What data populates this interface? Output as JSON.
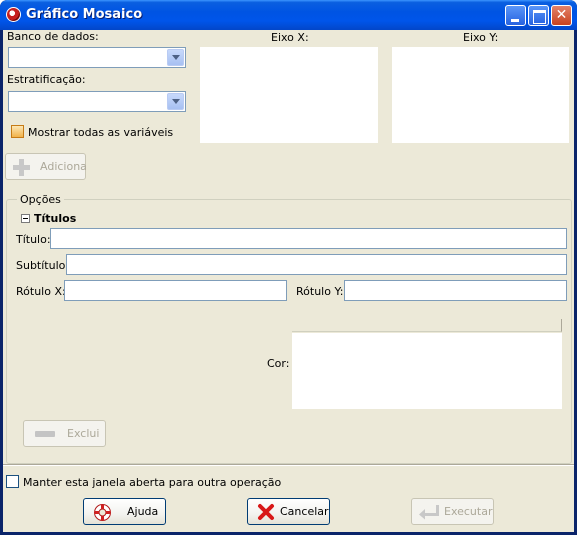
{
  "window": {
    "title": "Gráfico Mosaico",
    "close_glyph": "✕"
  },
  "selection": {
    "database_label": "Banco de dados:",
    "database_value": "",
    "stratification_label": "Estratificação:",
    "stratification_value": "",
    "show_all_label": "Mostrar todas as variáveis",
    "show_all_checked": false,
    "x_axis_label": "Eixo X:",
    "y_axis_label": "Eixo Y:",
    "add_button_label": "Adiciona",
    "add_icon": "plus-icon"
  },
  "options": {
    "group_label": "Opções",
    "titles_section_label": "Títulos",
    "title_label": "Título:",
    "title_value": "",
    "subtitle_label": "Subtítulo:",
    "subtitle_value": "",
    "x_label_label": "Rótulo X:",
    "x_label_value": "",
    "y_label_label": "Rótulo Y:",
    "y_label_value": "",
    "color_label": "Cor:",
    "remove_button_label": "Exclui",
    "remove_icon": "minus-icon"
  },
  "footer": {
    "keep_open_label": "Manter esta janela aberta para outra operação",
    "keep_open_checked": false,
    "help_button_label": "Ajuda",
    "help_icon": "lifebuoy-icon",
    "cancel_button_label": "Cancelar",
    "cancel_icon": "red-x-icon",
    "execute_button_label": "Executar",
    "execute_icon": "enter-arrow-icon"
  },
  "colors": {
    "titlebar": "#0054e3",
    "client_bg": "#ece9d8",
    "field_border": "#7f9db9",
    "disabled_text": "#aca899"
  }
}
